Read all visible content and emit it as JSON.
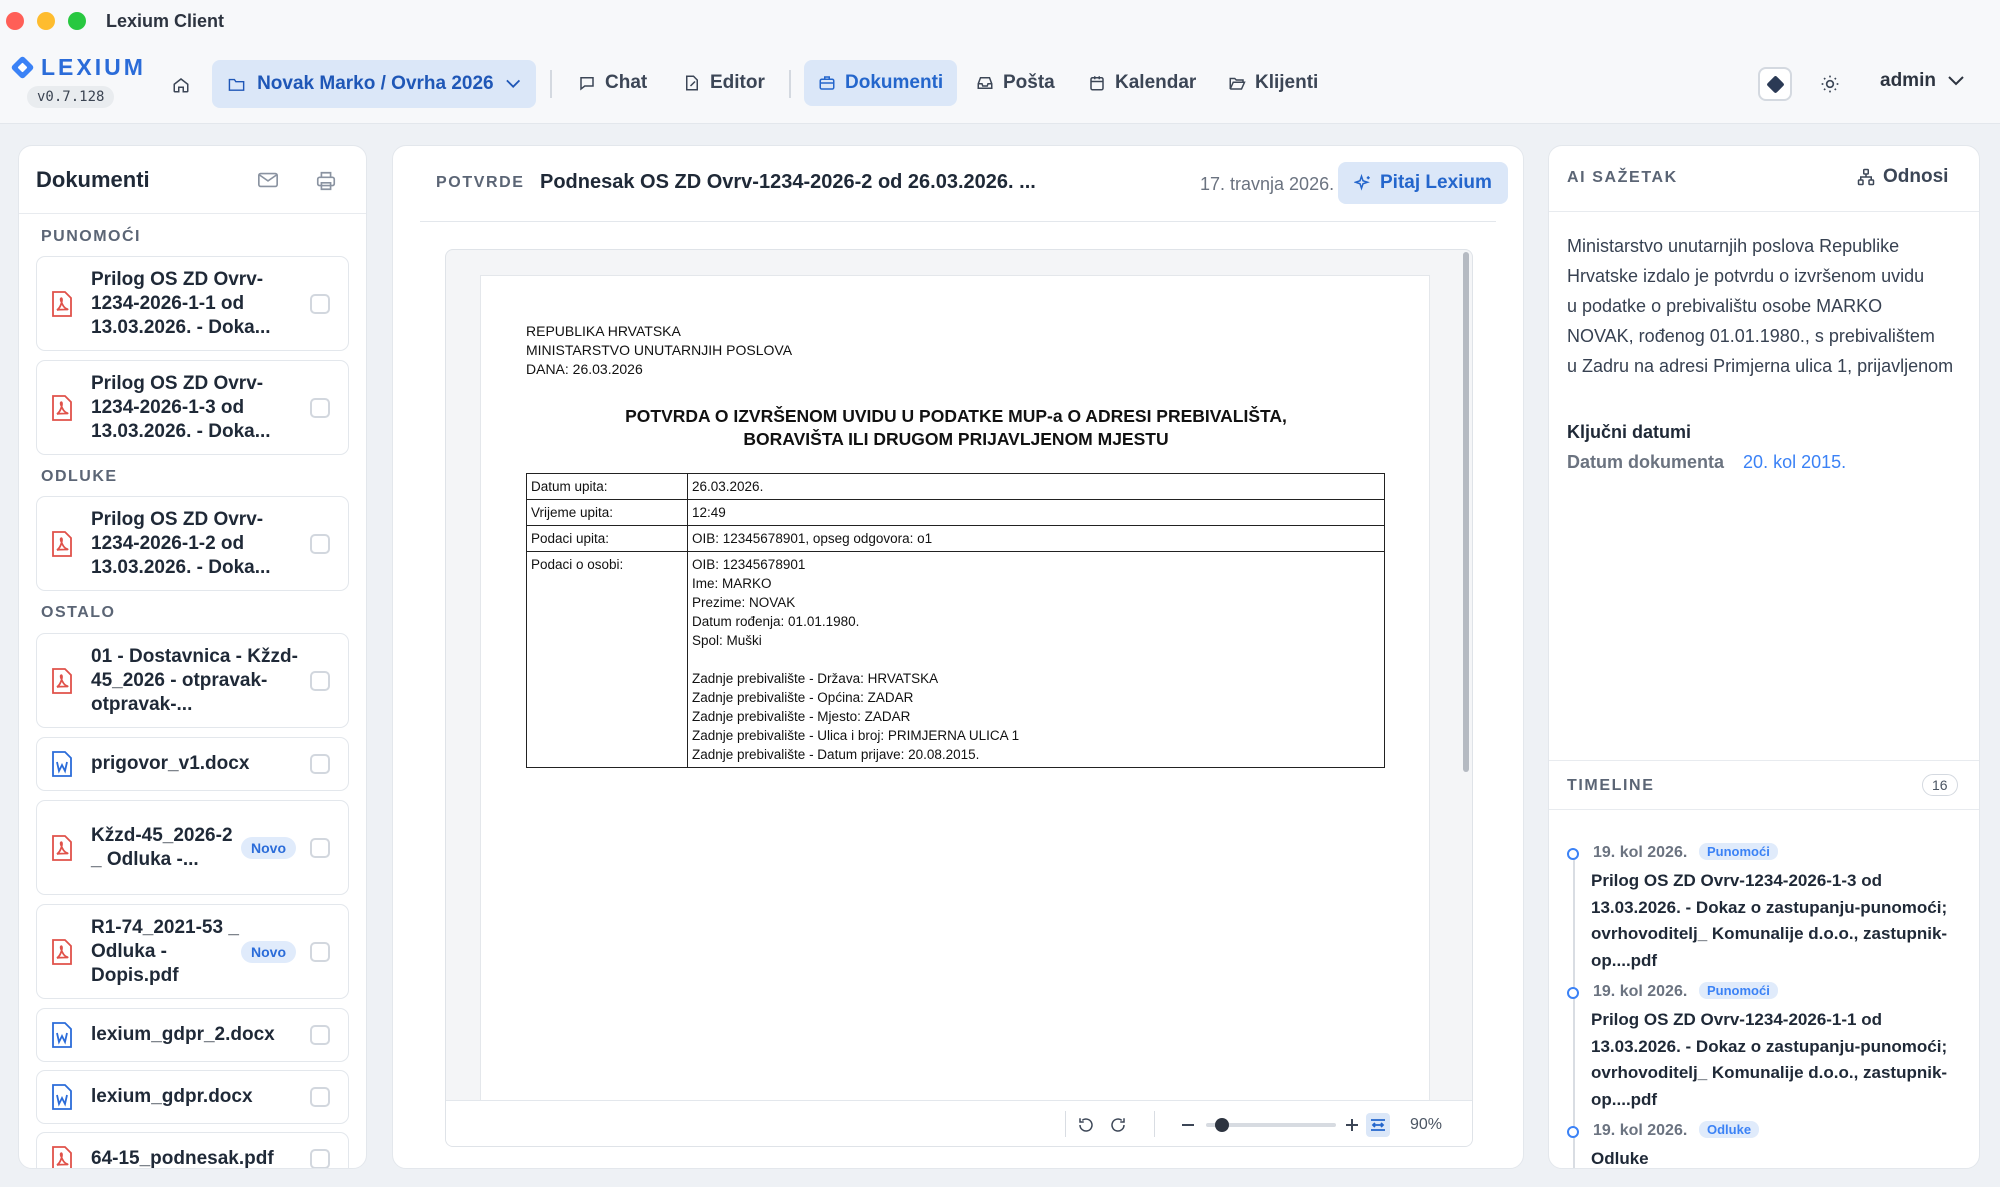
{
  "window": {
    "title": "Lexium Client"
  },
  "brand": {
    "name": "LEXIUM",
    "version": "v0.7.128"
  },
  "case_selector": {
    "value": "Novak Marko / Ovrha 2026"
  },
  "nav": {
    "chat": "Chat",
    "editor": "Editor",
    "documents": "Dokumenti",
    "mail": "Pošta",
    "calendar": "Kalendar",
    "clients": "Klijenti"
  },
  "user": {
    "name": "admin"
  },
  "colors": {
    "accent": "#2466cc",
    "accent_bg": "#dbe7f8",
    "pdf_red": "#e0524a",
    "word_blue": "#2b6cd9"
  },
  "documents_panel": {
    "title": "Dokumenti",
    "sections": [
      {
        "label": "PUNOMOĆI"
      },
      {
        "label": "ODLUKE"
      },
      {
        "label": "OSTALO"
      }
    ],
    "items": [
      {
        "name": "Prilog OS ZD Ovrv-1234-2026-1-1 od 13.03.2026. - Doka...",
        "icon": "pdf-icon",
        "badge": ""
      },
      {
        "name": "Prilog OS ZD Ovrv-1234-2026-1-3 od 13.03.2026. - Doka...",
        "icon": "pdf-icon",
        "badge": ""
      },
      {
        "name": "Prilog OS ZD Ovrv-1234-2026-1-2 od 13.03.2026. - Doka...",
        "icon": "pdf-icon",
        "badge": ""
      },
      {
        "name": "01 - Dostavnica - Kžzd-45_2026 - otpravak-otpravak-...",
        "icon": "pdf-icon",
        "badge": ""
      },
      {
        "name": "prigovor_v1.docx",
        "icon": "word-icon",
        "badge": ""
      },
      {
        "name": "Kžzd-45_2026-2 _ Odluka -...",
        "icon": "pdf-icon",
        "badge": "Novo"
      },
      {
        "name": "R1-74_2021-53 _ Odluka - Dopis.pdf",
        "icon": "pdf-icon",
        "badge": "Novo"
      },
      {
        "name": "lexium_gdpr_2.docx",
        "icon": "word-icon",
        "badge": ""
      },
      {
        "name": "lexium_gdpr.docx",
        "icon": "word-icon",
        "badge": ""
      },
      {
        "name": "64-15_podnesak.pdf",
        "icon": "pdf-icon",
        "badge": ""
      }
    ]
  },
  "document_view": {
    "category": "POTVRDE",
    "title": "Podnesak OS ZD Ovrv-1234-2026-2 od 26.03.2026. ...",
    "date": "17. travnja 2026.",
    "ask_button": "Pitaj Lexium",
    "page": {
      "header_lines": [
        "REPUBLIKA HRVATSKA",
        "MINISTARSTVO UNUTARNJIH POSLOVA",
        "DANA: 26.03.2026"
      ],
      "title_lines": [
        "POTVRDA O IZVRŠENOM UVIDU U PODATKE MUP-a O ADRESI PREBIVALIŠTA,",
        "BORAVIŠTA ILI DRUGOM PRIJAVLJENOM MJESTU"
      ],
      "rows": [
        {
          "key": "Datum upita:",
          "value": "26.03.2026."
        },
        {
          "key": "Vrijeme upita:",
          "value": "12:49"
        },
        {
          "key": "Podaci upita:",
          "value": "OIB: 12345678901, opseg odgovora: o1"
        }
      ],
      "person": {
        "key": "Podaci o osobi:",
        "lines": [
          "OIB: 12345678901",
          "Ime: MARKO",
          "Prezime: NOVAK",
          "Datum rođenja: 01.01.1980.",
          "Spol: Muški",
          "",
          "Zadnje prebivalište - Država: HRVATSKA",
          "Zadnje prebivalište - Općina: ZADAR",
          "Zadnje prebivalište - Mjesto: ZADAR",
          "Zadnje prebivalište - Ulica i broj: PRIMJERNA ULICA 1",
          "Zadnje prebivalište - Datum prijave: 20.08.2015."
        ]
      }
    },
    "toolbar": {
      "zoom": "90%",
      "zoom_fraction": 0.12
    }
  },
  "ai_summary": {
    "label": "AI SAŽETAK",
    "relations_button": "Odnosi",
    "lines": [
      "Ministarstvo unutarnjih poslova Republike",
      "Hrvatske izdalo je potvrdu o izvršenom uvidu",
      "u podatke o prebivalištu osobe MARKO",
      "NOVAK, rođenog 01.01.1980., s prebivalištem",
      "u Zadru na adresi Primjerna ulica 1, prijavljenom"
    ],
    "key_dates_title": "Ključni datumi",
    "key_dates": [
      {
        "label": "Datum dokumenta",
        "value": "20. kol 2015."
      }
    ]
  },
  "timeline": {
    "label": "TIMELINE",
    "count": "16",
    "items": [
      {
        "date": "19. kol 2026.",
        "tag": "Punomoći",
        "text": "Prilog OS ZD Ovrv-1234-2026-1-3 od 13.03.2026. - Dokaz o zastupanju-punomoći; ovrhovoditelj_ Komunalije d.o.o., zastupnik-op....pdf"
      },
      {
        "date": "19. kol 2026.",
        "tag": "Punomoći",
        "text": "Prilog OS ZD Ovrv-1234-2026-1-1 od 13.03.2026. - Dokaz o zastupanju-punomoći; ovrhovoditelj_ Komunalije d.o.o., zastupnik-op....pdf"
      },
      {
        "date": "19. kol 2026.",
        "tag": "Odluke",
        "text": "Odluke"
      }
    ]
  }
}
